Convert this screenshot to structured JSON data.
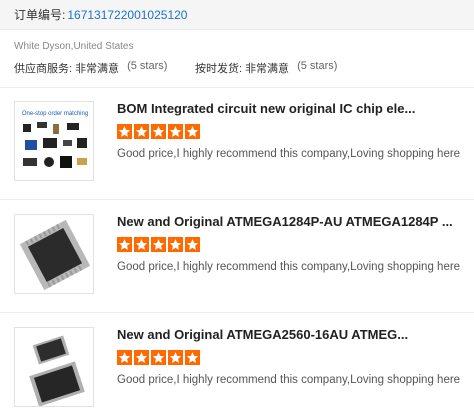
{
  "order": {
    "label": "订单编号:",
    "number": "167131722001025120"
  },
  "buyer": {
    "location": "White Dyson,United States"
  },
  "service_ratings": [
    {
      "label": "供应商服务:",
      "value": "非常满意",
      "stars_text": "(5 stars)"
    },
    {
      "label": "按时发货:",
      "value": "非常满意",
      "stars_text": "(5 stars)"
    }
  ],
  "products": [
    {
      "title": "BOM Integrated circuit new original IC chip ele...",
      "thumbnail_caption": "One-stop order matching",
      "rating": 5,
      "review": "Good price,I highly recommend this company,Loving shopping here"
    },
    {
      "title": "New and Original ATMEGA1284P-AU ATMEGA1284P ...",
      "rating": 5,
      "review": "Good price,I highly recommend this company,Loving shopping here"
    },
    {
      "title": "New and Original ATMEGA2560-16AU ATMEG...",
      "rating": 5,
      "review": "Good price,I highly recommend this company,Loving shopping here"
    }
  ],
  "colors": {
    "accent_link": "#1a73c8",
    "star": "#ff6a00"
  }
}
